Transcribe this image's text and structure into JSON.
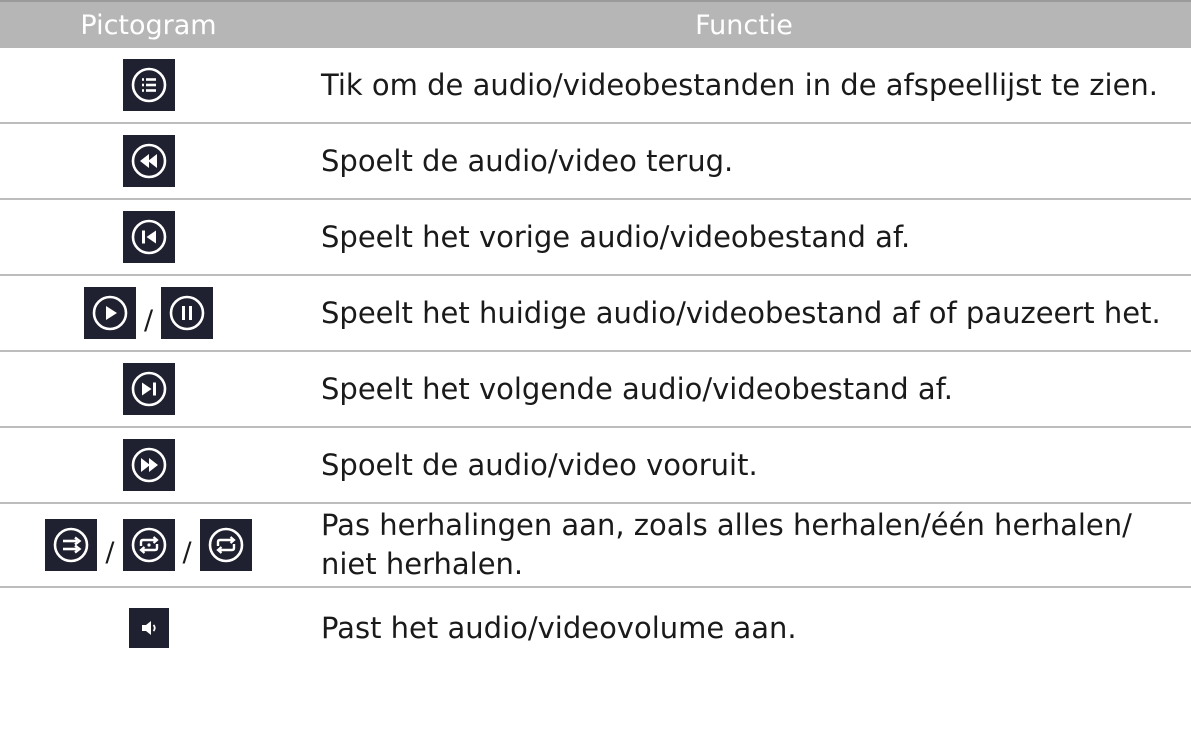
{
  "header": {
    "col_icon": "Pictogram",
    "col_function": "Functie"
  },
  "rows": [
    {
      "icons": [
        "playlist-icon"
      ],
      "text": "Tik om de audio/videobestanden in de afspeellijst te zien."
    },
    {
      "icons": [
        "rewind-icon"
      ],
      "text": "Spoelt de audio/video terug."
    },
    {
      "icons": [
        "previous-icon"
      ],
      "text": "Speelt het vorige audio/videobestand af."
    },
    {
      "icons": [
        "play-icon",
        "pause-icon"
      ],
      "text": "Speelt het huidige audio/videobestand af of pauzeert het."
    },
    {
      "icons": [
        "next-icon"
      ],
      "text": "Speelt het volgende audio/videobestand af."
    },
    {
      "icons": [
        "fast-forward-icon"
      ],
      "text": "Spoelt de audio/video vooruit."
    },
    {
      "icons": [
        "repeat-off-icon",
        "repeat-all-icon",
        "repeat-one-icon"
      ],
      "text": "Pas herhalingen aan, zoals alles herhalen/één herhalen/\nniet herhalen."
    },
    {
      "icons": [
        "volume-icon"
      ],
      "text": "Past het audio/videovolume aan."
    }
  ],
  "separator": "/",
  "colors": {
    "header_bg": "#b6b6b6",
    "icon_bg": "#1f2030",
    "icon_fg": "#ffffff",
    "divider": "#bdbdbd"
  }
}
